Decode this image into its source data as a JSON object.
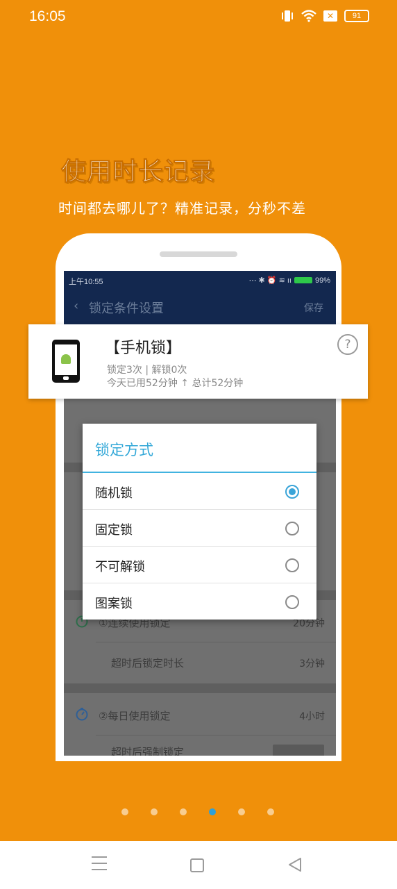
{
  "status_bar": {
    "time": "16:05",
    "battery": "91"
  },
  "promo": {
    "headline": "使用时长记录",
    "subline": "时间都去哪儿了？精准记录，分秒不差"
  },
  "screen": {
    "status_time": "上午10:55",
    "status_battery": "99%",
    "title": "锁定条件设置",
    "save": "保存",
    "rows": {
      "continuous_label": "①连续使用锁定",
      "continuous_value": "20分钟",
      "timeout_label": "超时后锁定时长",
      "timeout_value": "3分钟",
      "daily_label": "②每日使用锁定",
      "daily_value": "4小时",
      "force_label": "超时后强制锁定"
    }
  },
  "card": {
    "title": "【手机锁】",
    "line1": "锁定3次 | 解锁0次",
    "line2": "今天已用52分钟 ↑ 总计52分钟",
    "help": "?"
  },
  "dialog": {
    "title": "锁定方式",
    "options": [
      {
        "label": "随机锁",
        "selected": true
      },
      {
        "label": "固定锁",
        "selected": false
      },
      {
        "label": "不可解锁",
        "selected": false
      },
      {
        "label": "图案锁",
        "selected": false
      }
    ]
  },
  "pagination": {
    "count": 6,
    "active_index": 3
  },
  "colors": {
    "background": "#F0900A",
    "accent": "#3AA4D8",
    "header": "#13284F"
  }
}
